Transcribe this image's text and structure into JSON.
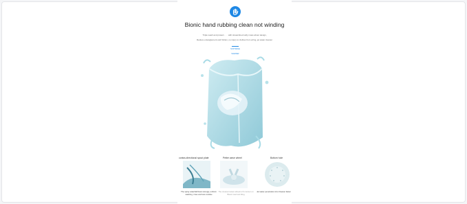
{
  "product": {
    "title": "Bionic hand rubbing clean not winding",
    "desc_line1": "Triple wash and protect · · · with streamlined softy mass about design,",
    "desc_line2": "Reduce entanglement and friction, no injury to clothes from wring, jet water cleaner",
    "logo_text": "SOFTWAVE WASHER",
    "icon": "hand-icon"
  },
  "features": [
    {
      "caption": "contra-directional spout plate",
      "note": "The spray waterfall flows strongly, uniform washing, rinse and less residue"
    },
    {
      "caption": "Petter wave wheel",
      "note": "The crescent wave wheel is fit contour on Bionic real rest tiling"
    },
    {
      "caption": "Bottom hole",
      "note": "Jet water penetration into Cleaner faster"
    }
  ],
  "colors": {
    "accent": "#1e88e5",
    "water": "#9fd3e0"
  }
}
